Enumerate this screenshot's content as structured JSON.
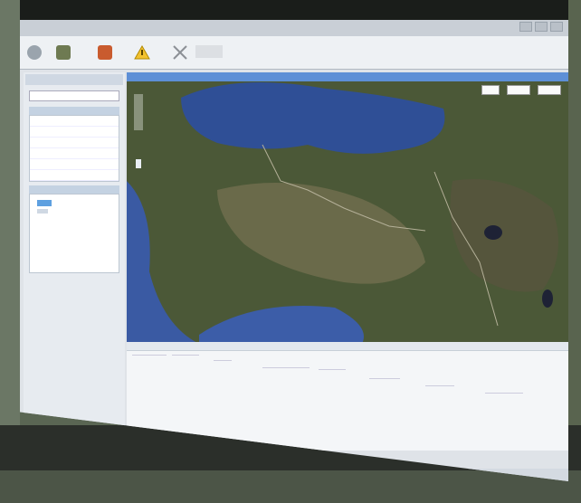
{
  "window": {
    "title": ""
  },
  "toolbar": {
    "items": [
      {
        "name": "home",
        "label": ""
      },
      {
        "name": "vehicle",
        "label": ""
      },
      {
        "name": "people",
        "label": ""
      },
      {
        "name": "alert",
        "label": ""
      },
      {
        "name": "tools",
        "label": ""
      }
    ]
  },
  "sidebar": {
    "search_placeholder": "",
    "panel1_title": "",
    "panel1_rows": [
      {
        "name": "",
        "count": ""
      },
      {
        "name": "",
        "count": ""
      },
      {
        "name": "",
        "count": ""
      },
      {
        "name": "",
        "count": ""
      },
      {
        "name": "",
        "count": ""
      },
      {
        "name": "",
        "count": ""
      }
    ],
    "panel2_title": ""
  },
  "map": {
    "header": "",
    "controls": [
      "",
      "",
      ""
    ]
  },
  "status": {
    "text": ""
  }
}
